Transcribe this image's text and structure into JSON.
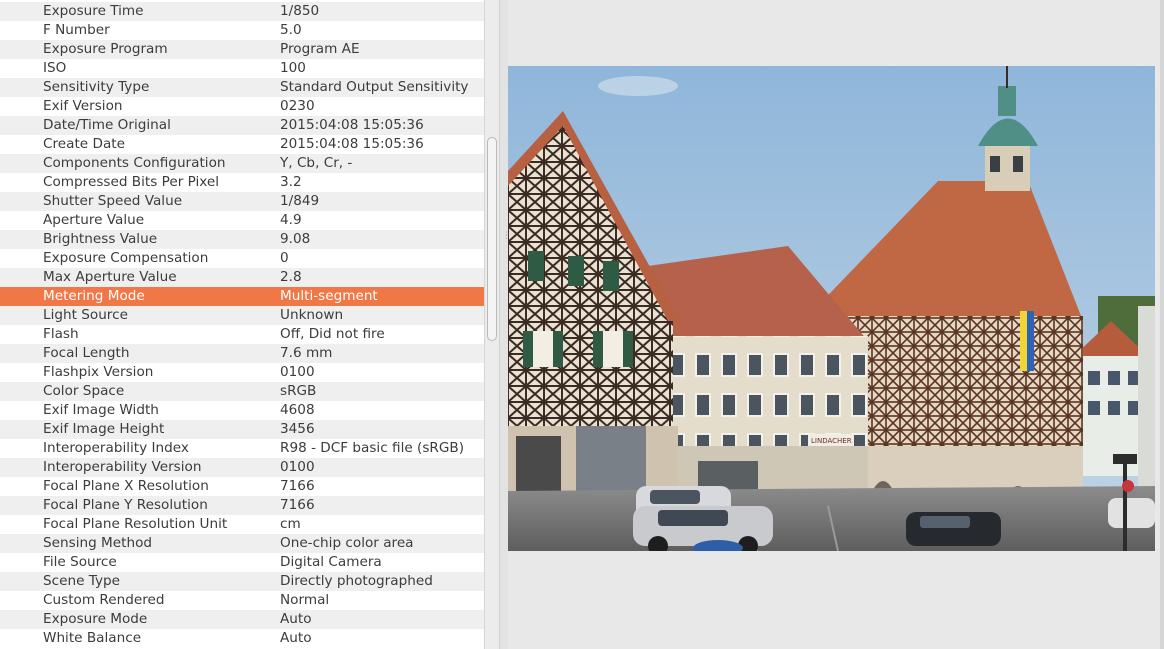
{
  "metadata": {
    "rows": [
      {
        "key": "Exposure Time",
        "value": "1/850"
      },
      {
        "key": "F Number",
        "value": "5.0"
      },
      {
        "key": "Exposure Program",
        "value": "Program AE"
      },
      {
        "key": "ISO",
        "value": "100"
      },
      {
        "key": "Sensitivity Type",
        "value": "Standard Output Sensitivity"
      },
      {
        "key": "Exif Version",
        "value": "0230"
      },
      {
        "key": "Date/Time Original",
        "value": "2015:04:08 15:05:36"
      },
      {
        "key": "Create Date",
        "value": "2015:04:08 15:05:36"
      },
      {
        "key": "Components Configuration",
        "value": "Y, Cb, Cr, -"
      },
      {
        "key": "Compressed Bits Per Pixel",
        "value": "3.2"
      },
      {
        "key": "Shutter Speed Value",
        "value": "1/849"
      },
      {
        "key": "Aperture Value",
        "value": "4.9"
      },
      {
        "key": "Brightness Value",
        "value": "9.08"
      },
      {
        "key": "Exposure Compensation",
        "value": "0"
      },
      {
        "key": "Max Aperture Value",
        "value": "2.8"
      },
      {
        "key": "Metering Mode",
        "value": "Multi-segment"
      },
      {
        "key": "Light Source",
        "value": "Unknown"
      },
      {
        "key": "Flash",
        "value": "Off, Did not fire"
      },
      {
        "key": "Focal Length",
        "value": "7.6 mm"
      },
      {
        "key": "Flashpix Version",
        "value": "0100"
      },
      {
        "key": "Color Space",
        "value": "sRGB"
      },
      {
        "key": "Exif Image Width",
        "value": "4608"
      },
      {
        "key": "Exif Image Height",
        "value": "3456"
      },
      {
        "key": "Interoperability Index",
        "value": "R98 - DCF basic file (sRGB)"
      },
      {
        "key": "Interoperability Version",
        "value": "0100"
      },
      {
        "key": "Focal Plane X Resolution",
        "value": "7166"
      },
      {
        "key": "Focal Plane Y Resolution",
        "value": "7166"
      },
      {
        "key": "Focal Plane Resolution Unit",
        "value": "cm"
      },
      {
        "key": "Sensing Method",
        "value": "One-chip color area"
      },
      {
        "key": "File Source",
        "value": "Digital Camera"
      },
      {
        "key": "Scene Type",
        "value": "Directly photographed"
      },
      {
        "key": "Custom Rendered",
        "value": "Normal"
      },
      {
        "key": "Exposure Mode",
        "value": "Auto"
      },
      {
        "key": "White Balance",
        "value": "Auto"
      }
    ],
    "selected_key": "Metering Mode"
  },
  "preview": {
    "signs": {
      "shop": "LINDACHER"
    }
  },
  "colors": {
    "selection": "#f07746",
    "row_alt": "#efefef",
    "text": "#3c3c3c",
    "sky": "#a9c6e0",
    "roof": "#c46a4a"
  }
}
